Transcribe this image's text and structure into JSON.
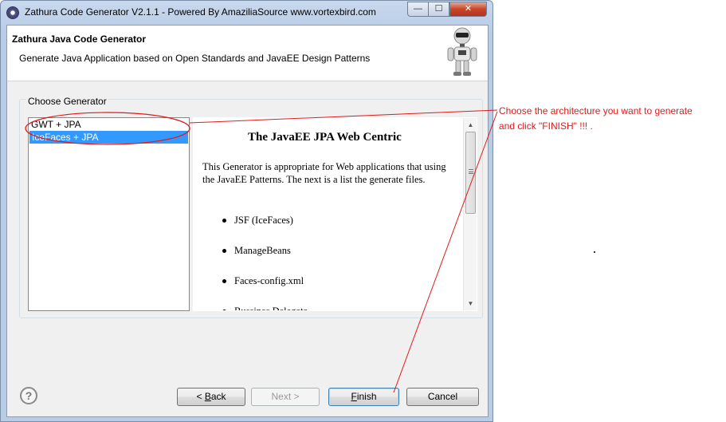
{
  "window": {
    "title": "Zathura Code Generator V2.1.1 - Powered By AmaziliaSource www.vortexbird.com",
    "controls": {
      "minimize": "—",
      "maximize": "☐",
      "close": "✕"
    }
  },
  "header": {
    "title": "Zathura Java Code Generator",
    "description": "Generate Java Application based on Open Standards and JavaEE Design Patterns"
  },
  "generator_group": {
    "label": "Choose Generator",
    "items": [
      {
        "label": "GWT + JPA",
        "selected": false
      },
      {
        "label": "IceFaces + JPA",
        "selected": true
      }
    ]
  },
  "description_panel": {
    "title": "The JavaEE JPA Web Centric",
    "paragraph": "This Generator is appropriate for Web applications that using the JavaEE Patterns. The next is a list the generate files.",
    "files": [
      "JSF (IceFaces)",
      "ManageBeans",
      "Faces-config.xml",
      "Bussines Delegate"
    ]
  },
  "buttons": {
    "help": "?",
    "back": {
      "prefix": "< ",
      "mnemonic": "B",
      "rest": "ack"
    },
    "next": {
      "text": "Next >",
      "enabled": false
    },
    "finish": {
      "mnemonic": "F",
      "rest": "inish"
    },
    "cancel": "Cancel"
  },
  "annotation": {
    "line1": "Choose the architecture you want to generate",
    "line2": "and click \"FINISH\" !!! .",
    "color": "#e11b1b"
  },
  "colors": {
    "selection": "#3399ff",
    "dialog_bg": "#f0f0f0",
    "annotation": "#e11b1b"
  }
}
